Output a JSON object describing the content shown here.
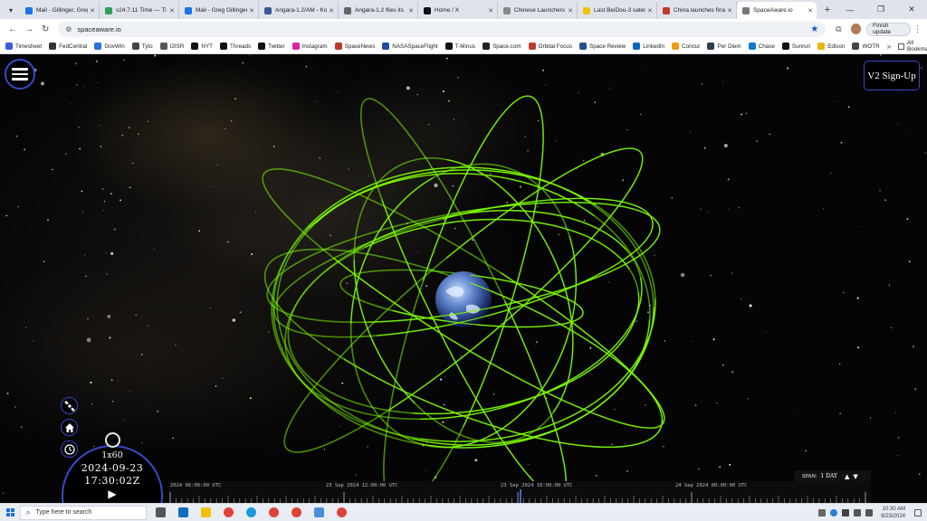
{
  "browser": {
    "tabs": [
      {
        "label": "Mail - Gillinger, Greg",
        "color": "#1a73e8"
      },
      {
        "label": "v24.7.11 Time — Ti",
        "color": "#2e9e5b"
      },
      {
        "label": "Mail - Greg Gillinger",
        "color": "#1a73e8"
      },
      {
        "label": "Angara-1.2/AM - Ko",
        "color": "#3b5998"
      },
      {
        "label": "Angara-1.2 flies its",
        "color": "#666666"
      },
      {
        "label": "Home / X",
        "color": "#111111"
      },
      {
        "label": "Chinese Launchers",
        "color": "#888888"
      },
      {
        "label": "Last BeiDou-3 satel",
        "color": "#f2c200"
      },
      {
        "label": "China launches fina",
        "color": "#c0392b"
      },
      {
        "label": "SpaceAware.io",
        "color": "#777777"
      }
    ],
    "active_tab_index": 9,
    "url": "spaceaware.io",
    "finish_update_label": "Finish update",
    "bookmarks": [
      {
        "label": "Timesheet",
        "color": "#3b5bdb"
      },
      {
        "label": "FedCentral",
        "color": "#333333"
      },
      {
        "label": "GovWin",
        "color": "#2a6fdb"
      },
      {
        "label": "Tyto",
        "color": "#444444"
      },
      {
        "label": "I2ISR",
        "color": "#555555"
      },
      {
        "label": "NYT",
        "color": "#111111"
      },
      {
        "label": "Threads",
        "color": "#111111"
      },
      {
        "label": "Twitter",
        "color": "#111111"
      },
      {
        "label": "Instagram",
        "color": "#d6249f"
      },
      {
        "label": "SpaceNews",
        "color": "#c0392b"
      },
      {
        "label": "NASASpaceFlight",
        "color": "#1f4e9e"
      },
      {
        "label": "T-Minus",
        "color": "#111111"
      },
      {
        "label": "Space.com",
        "color": "#222222"
      },
      {
        "label": "Orbital Focus",
        "color": "#c0392b"
      },
      {
        "label": "Space Review",
        "color": "#2a4d8f"
      },
      {
        "label": "LinkedIn",
        "color": "#0a66c2"
      },
      {
        "label": "Concur",
        "color": "#f39c12"
      },
      {
        "label": "Per Diem",
        "color": "#2c3e50"
      },
      {
        "label": "Chase",
        "color": "#117aca"
      },
      {
        "label": "Sunrun",
        "color": "#111111"
      },
      {
        "label": "Edison",
        "color": "#e6b800"
      },
      {
        "label": "WOTR",
        "color": "#444444"
      }
    ],
    "all_bookmarks_label": "All Bookmarks"
  },
  "app": {
    "signup_label": "V2 Sign-Up",
    "speed": "1x60",
    "date": "2024-09-23",
    "time": "17:30:02Z",
    "span_label": "SPAN:",
    "span_value": "1 DAY",
    "timeline_labels": [
      "2024 06:00:00 UTC",
      "23 Sep 2024 12:00:00 UTC",
      "23 Sep 2024 18:00:00 UTC",
      "24 Sep 2024 00:00:00 UTC"
    ],
    "orbit_color": "#7cfc00",
    "accent_color": "#3949c8"
  },
  "taskbar": {
    "search_placeholder": "Type here to search",
    "time": "10:30 AM",
    "date": "9/23/2024",
    "apps": [
      {
        "name": "task-view-icon",
        "color": "#555555"
      },
      {
        "name": "outlook-icon",
        "color": "#0f6cbd"
      },
      {
        "name": "file-explorer-icon",
        "color": "#f2c200"
      },
      {
        "name": "chrome-icon",
        "color": "#db4437"
      },
      {
        "name": "edge-icon",
        "color": "#1a9bd7"
      },
      {
        "name": "chrome-icon-2",
        "color": "#db4437"
      },
      {
        "name": "chrome-icon-3",
        "color": "#db4437"
      },
      {
        "name": "notepad-icon",
        "color": "#4a90d9"
      },
      {
        "name": "chrome-icon-4",
        "color": "#db4437"
      }
    ]
  }
}
